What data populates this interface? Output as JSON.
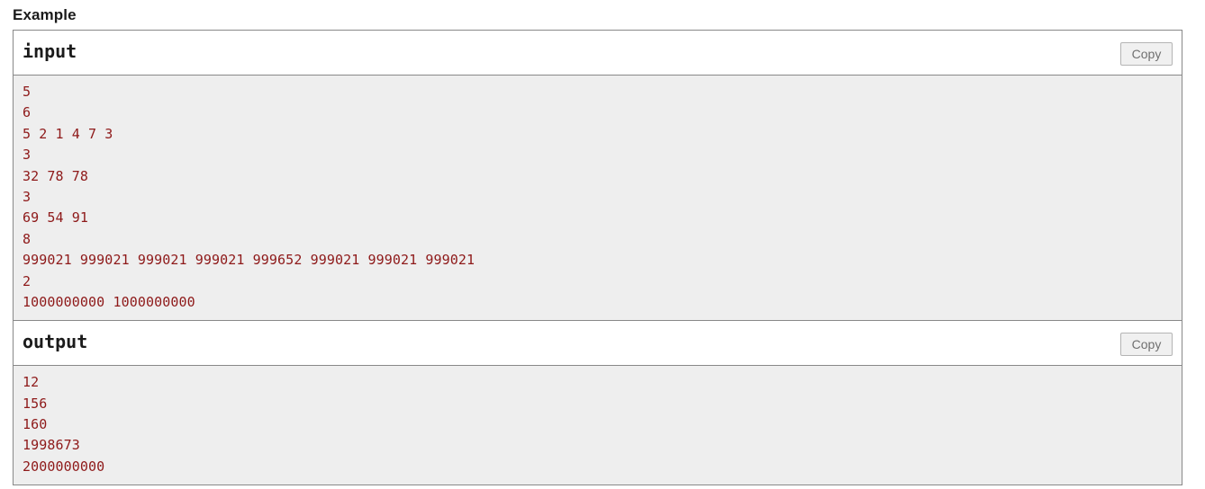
{
  "page": {
    "section_title": "Example",
    "colors": {
      "sample_text": "#8e1919",
      "content_bg": "#eeeeee",
      "header_bg": "#ffffff",
      "border": "#888888",
      "copy_button_bg": "#f0f0f0",
      "copy_button_text": "#707070",
      "title_text": "#1b1b1b"
    }
  },
  "samples": [
    {
      "title": "input",
      "copy_label": "Copy",
      "lines": [
        "5",
        "6",
        "5 2 1 4 7 3",
        "3",
        "32 78 78",
        "3",
        "69 54 91",
        "8",
        "999021 999021 999021 999021 999652 999021 999021 999021",
        "2",
        "1000000000 1000000000"
      ]
    },
    {
      "title": "output",
      "copy_label": "Copy",
      "lines": [
        "12",
        "156",
        "160",
        "1998673",
        "2000000000"
      ]
    }
  ]
}
